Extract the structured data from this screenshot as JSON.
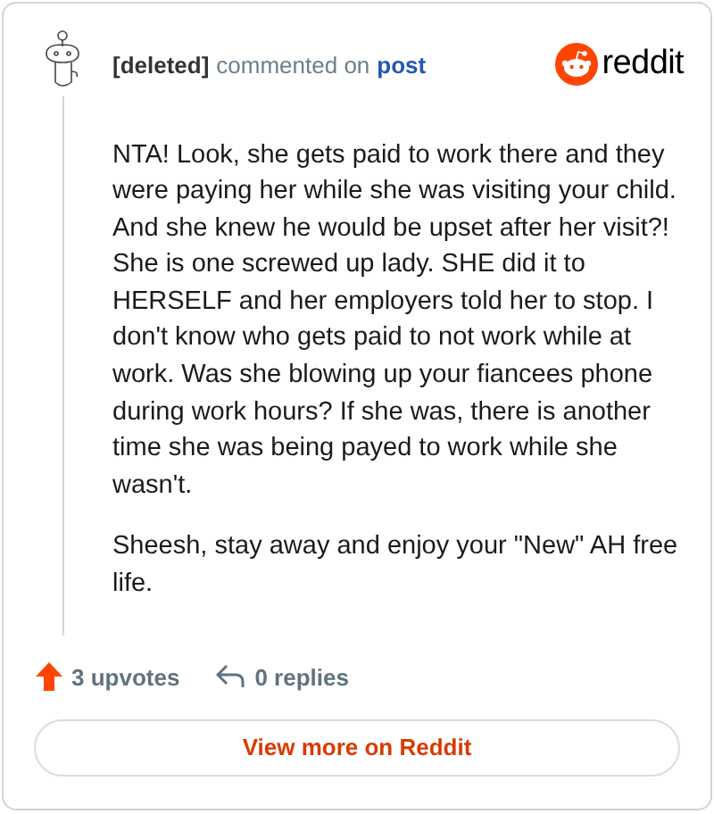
{
  "header": {
    "author": "[deleted]",
    "action": "commented on",
    "link": "post",
    "logo_text": "reddit"
  },
  "body": [
    "NTA! Look, she gets paid to work there and they were paying her while she was visiting your child. And she knew he would be upset after her visit?! She is one screwed up lady. SHE did it to HERSELF and her employers told her to stop. I don't know who gets paid to not work while at work. Was she blowing up your fiancees phone during work hours? If she was, there is another time she was being payed to work while she wasn't.",
    "Sheesh, stay away and enjoy your \"New\" AH free life."
  ],
  "footer": {
    "upvotes": "3 upvotes",
    "replies": "0 replies"
  },
  "button": "View more on Reddit"
}
